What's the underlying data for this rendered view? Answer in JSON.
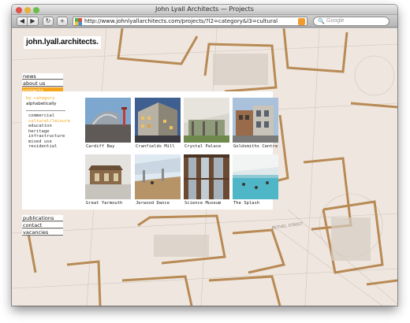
{
  "browser": {
    "window_title": "John Lyall Architects — Projects",
    "url": "http://www.johnlyallarchitects.com/projects/?l2=category&l3=cultural",
    "search_placeholder": "Google",
    "back_label": "◀",
    "forward_label": "▶",
    "reload_label": "↻",
    "add_label": "+"
  },
  "site": {
    "logo": "john.lyall.architects.",
    "nav_top": [
      {
        "label": "news",
        "active": false
      },
      {
        "label": "about us",
        "active": false
      },
      {
        "label": "projects",
        "active": true
      }
    ],
    "sort_by_category": "by category",
    "sort_alphabetically": "alphabetically",
    "categories": [
      {
        "label": "commercial",
        "selected": false
      },
      {
        "label": "cultural/leisure",
        "selected": true
      },
      {
        "label": "education",
        "selected": false
      },
      {
        "label": "heritage",
        "selected": false
      },
      {
        "label": "infrastructure",
        "selected": false
      },
      {
        "label": "mixed use",
        "selected": false
      },
      {
        "label": "residential",
        "selected": false
      }
    ],
    "projects": [
      {
        "name": "Cardiff Bay"
      },
      {
        "name": "Cranfields Mill"
      },
      {
        "name": "Crystal Palace"
      },
      {
        "name": "Goldsmiths Centre"
      },
      {
        "name": "Great Yarmouth"
      },
      {
        "name": "Jerwood Dance"
      },
      {
        "name": "Science Museum"
      },
      {
        "name": "The Splash"
      }
    ],
    "nav_bottom": [
      {
        "label": "publications"
      },
      {
        "label": "contact"
      },
      {
        "label": "vacancies"
      }
    ]
  },
  "colors": {
    "accent": "#f4a51a",
    "background_plan": "#efe7df",
    "wall": "#b88a55"
  }
}
